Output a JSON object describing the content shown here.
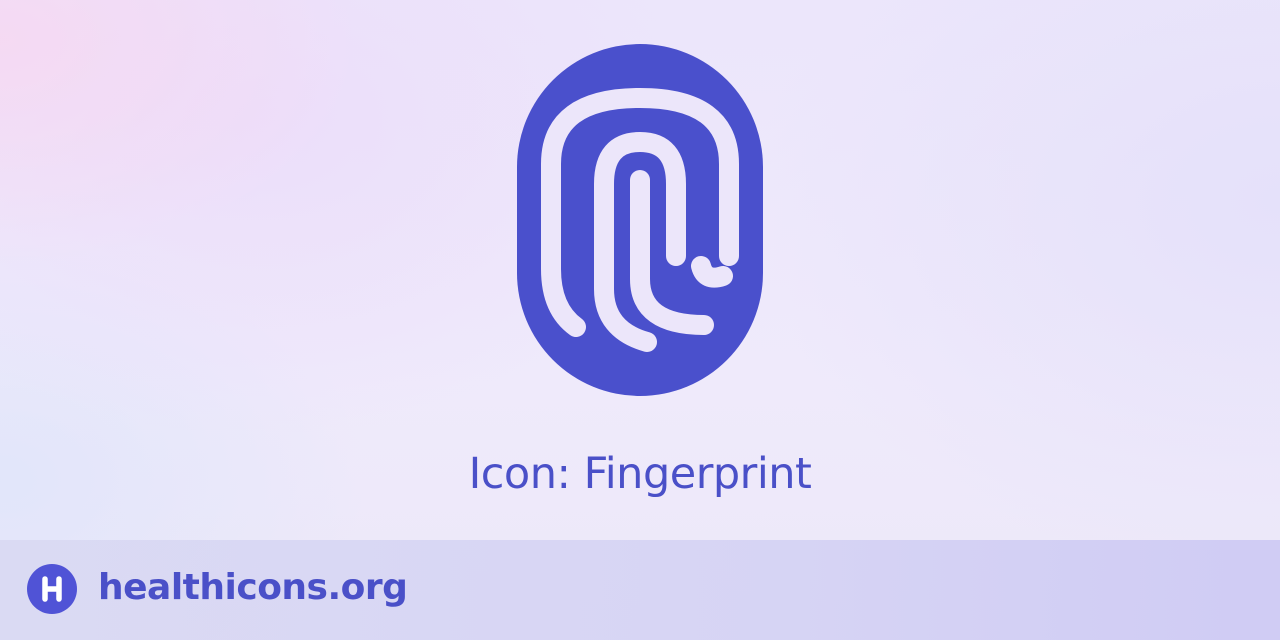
{
  "title": "Icon: Fingerprint",
  "icon": {
    "name": "fingerprint-icon",
    "color": "#4a50cc",
    "line_color": "#ece6fa"
  },
  "footer": {
    "site": "healthicons.org",
    "logo_icon": "healthicons-logo-icon",
    "logo_color": "#5053d6"
  }
}
